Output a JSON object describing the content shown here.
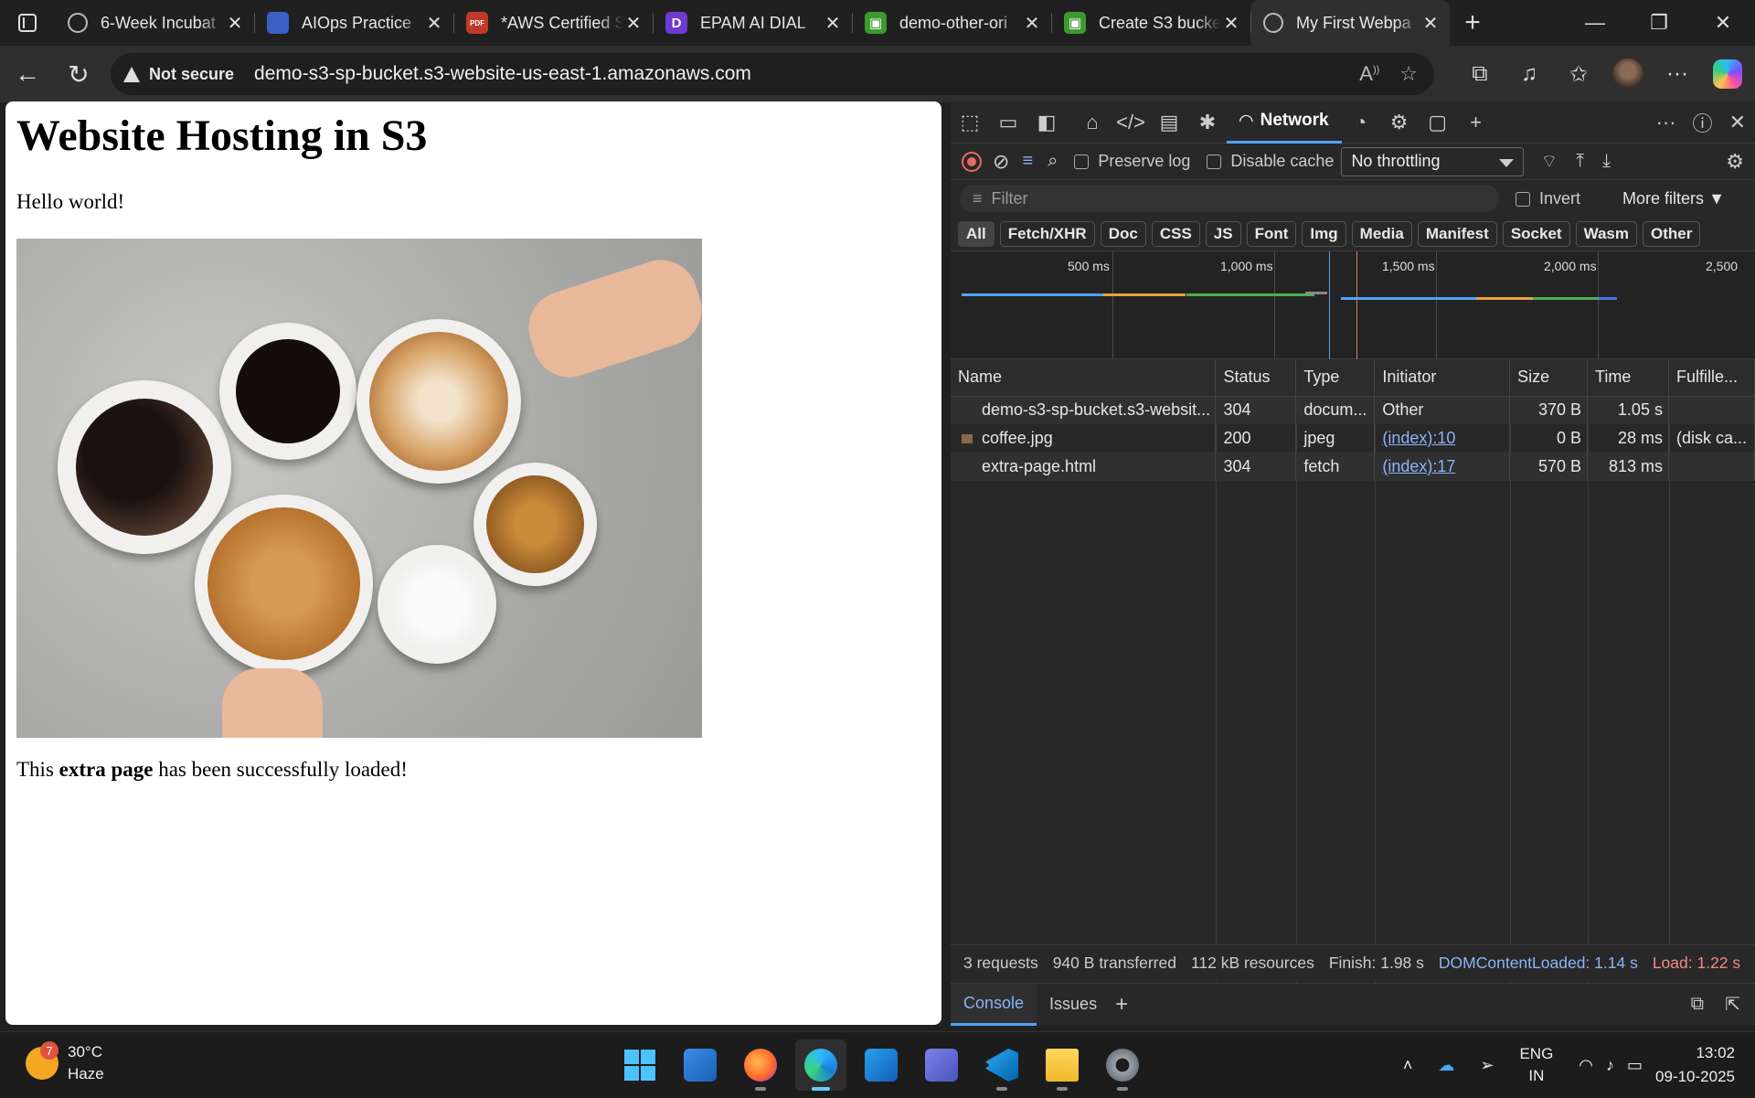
{
  "browser": {
    "tabs": [
      {
        "title": "6-Week Incubat",
        "favicon": "globe-icon"
      },
      {
        "title": "AIOps Practice",
        "favicon": "doc-icon"
      },
      {
        "title": "*AWS Certified S",
        "favicon": "pdf-icon"
      },
      {
        "title": "EPAM AI DIAL",
        "favicon": "dial-icon"
      },
      {
        "title": "demo-other-ori",
        "favicon": "s3-icon"
      },
      {
        "title": "Create S3 bucke",
        "favicon": "s3-icon"
      },
      {
        "title": "My First Webpa",
        "favicon": "globe-icon",
        "active": true
      }
    ],
    "new_tab": "+",
    "security": "Not secure",
    "url": "demo-s3-sp-bucket.s3-website-us-east-1.amazonaws.com"
  },
  "page": {
    "heading": "Website Hosting in S3",
    "hello": "Hello world!",
    "extra_prefix": "This ",
    "extra_bold": "extra page",
    "extra_suffix": " has been successfully loaded!"
  },
  "devtools": {
    "active_tab": "Network",
    "preserve_log": "Preserve log",
    "disable_cache": "Disable cache",
    "throttling": "No throttling",
    "filter_placeholder": "Filter",
    "invert": "Invert",
    "more_filters": "More filters",
    "type_filters": [
      "All",
      "Fetch/XHR",
      "Doc",
      "CSS",
      "JS",
      "Font",
      "Img",
      "Media",
      "Manifest",
      "Socket",
      "Wasm",
      "Other"
    ],
    "timeline_ticks": [
      "500 ms",
      "1,000 ms",
      "1,500 ms",
      "2,000 ms",
      "2,500"
    ],
    "columns": [
      "Name",
      "Status",
      "Type",
      "Initiator",
      "Size",
      "Time",
      "Fulfille..."
    ],
    "requests": [
      {
        "name": "demo-s3-sp-bucket.s3-websit...",
        "status": "304",
        "type": "docum...",
        "initiator": "Other",
        "size": "370 B",
        "time": "1.05 s",
        "fulfilled": ""
      },
      {
        "name": "coffee.jpg",
        "status": "200",
        "type": "jpeg",
        "initiator": "(index):10",
        "size": "0 B",
        "time": "28 ms",
        "fulfilled": "(disk ca..."
      },
      {
        "name": "extra-page.html",
        "status": "304",
        "type": "fetch",
        "initiator": "(index):17",
        "size": "570 B",
        "time": "813 ms",
        "fulfilled": ""
      }
    ],
    "summary": {
      "requests": "3 requests",
      "transferred": "940 B transferred",
      "resources": "112 kB resources",
      "finish": "Finish: 1.98 s",
      "dcl": "DOMContentLoaded: 1.14 s",
      "load": "Load: 1.22 s"
    },
    "drawer_tabs": [
      "Console",
      "Issues"
    ]
  },
  "taskbar": {
    "weather_temp": "30°C",
    "weather_desc": "Haze",
    "weather_badge": "7",
    "lang_1": "ENG",
    "lang_2": "IN",
    "time": "13:02",
    "date": "09-10-2025"
  }
}
